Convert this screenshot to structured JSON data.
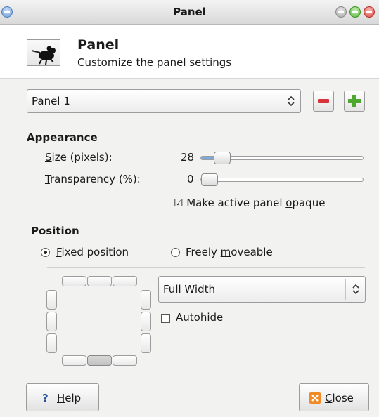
{
  "window": {
    "title": "Panel"
  },
  "header": {
    "title": "Panel",
    "subtitle": "Customize the panel settings",
    "icon": "mouse-icon"
  },
  "panel_select": {
    "value": "Panel 1"
  },
  "appearance": {
    "heading": "Appearance",
    "size_label_pre": "",
    "size_label_u": "S",
    "size_label_post": "ize (pixels):",
    "size_value": "28",
    "size_level": 0.18,
    "transparency_label_u": "T",
    "transparency_label_post": "ransparency (%):",
    "transparency_value": "0",
    "opaque_pre": "Make active panel ",
    "opaque_u": "o",
    "opaque_post": "paque",
    "opaque_checked": "☑"
  },
  "position": {
    "heading": "Position",
    "fixed_u": "F",
    "fixed_post": "ixed position",
    "free_pre": "Freely ",
    "free_u": "m",
    "free_post": "oveable",
    "width_select": "Full Width",
    "autohide_pre": "Auto",
    "autohide_u": "h",
    "autohide_post": "ide"
  },
  "buttons": {
    "help_icon": "?",
    "help_u": "H",
    "help_post": "elp",
    "close_u": "C",
    "close_post": "lose"
  },
  "colors": {
    "remove": "#d9333a",
    "add": "#4ea82f",
    "slider_fill": "#7fa8dc",
    "close_icon": "#f08a25"
  }
}
